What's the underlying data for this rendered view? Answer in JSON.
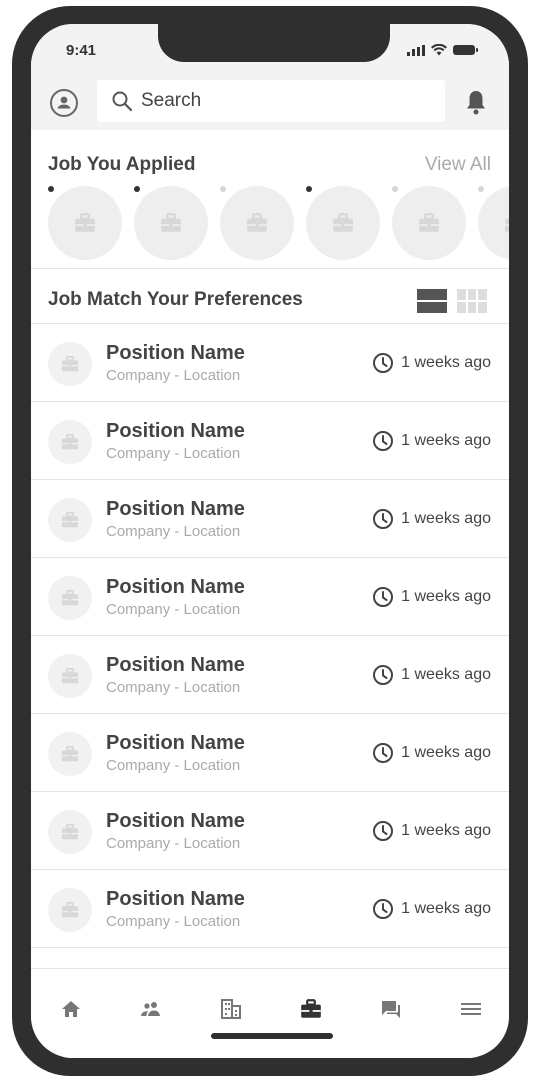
{
  "status_bar": {
    "time": "9:41"
  },
  "header": {
    "search_placeholder": "Search"
  },
  "applied": {
    "title": "Job You Applied",
    "view_all": "View All",
    "items": [
      {
        "status": "active"
      },
      {
        "status": "active"
      },
      {
        "status": "inactive"
      },
      {
        "status": "active"
      },
      {
        "status": "inactive"
      },
      {
        "status": "inactive"
      }
    ]
  },
  "preferences": {
    "title": "Job Match Your Preferences",
    "jobs": [
      {
        "position": "Position Name",
        "company": "Company - Location",
        "time": "1 weeks ago"
      },
      {
        "position": "Position Name",
        "company": "Company - Location",
        "time": "1 weeks ago"
      },
      {
        "position": "Position Name",
        "company": "Company - Location",
        "time": "1 weeks ago"
      },
      {
        "position": "Position Name",
        "company": "Company - Location",
        "time": "1 weeks ago"
      },
      {
        "position": "Position Name",
        "company": "Company - Location",
        "time": "1 weeks ago"
      },
      {
        "position": "Position Name",
        "company": "Company - Location",
        "time": "1 weeks ago"
      },
      {
        "position": "Position Name",
        "company": "Company - Location",
        "time": "1 weeks ago"
      },
      {
        "position": "Position Name",
        "company": "Company - Location",
        "time": "1 weeks ago"
      }
    ]
  },
  "nav": {
    "items": [
      {
        "icon": "home-icon",
        "active": false
      },
      {
        "icon": "people-icon",
        "active": false
      },
      {
        "icon": "building-icon",
        "active": false
      },
      {
        "icon": "briefcase-icon",
        "active": true
      },
      {
        "icon": "chat-icon",
        "active": false
      },
      {
        "icon": "menu-icon",
        "active": false
      }
    ]
  },
  "colors": {
    "frame": "#2f2f2f",
    "active_dot": "#333333",
    "inactive_dot": "#d6d6d6",
    "muted": "#aaaaaa"
  }
}
